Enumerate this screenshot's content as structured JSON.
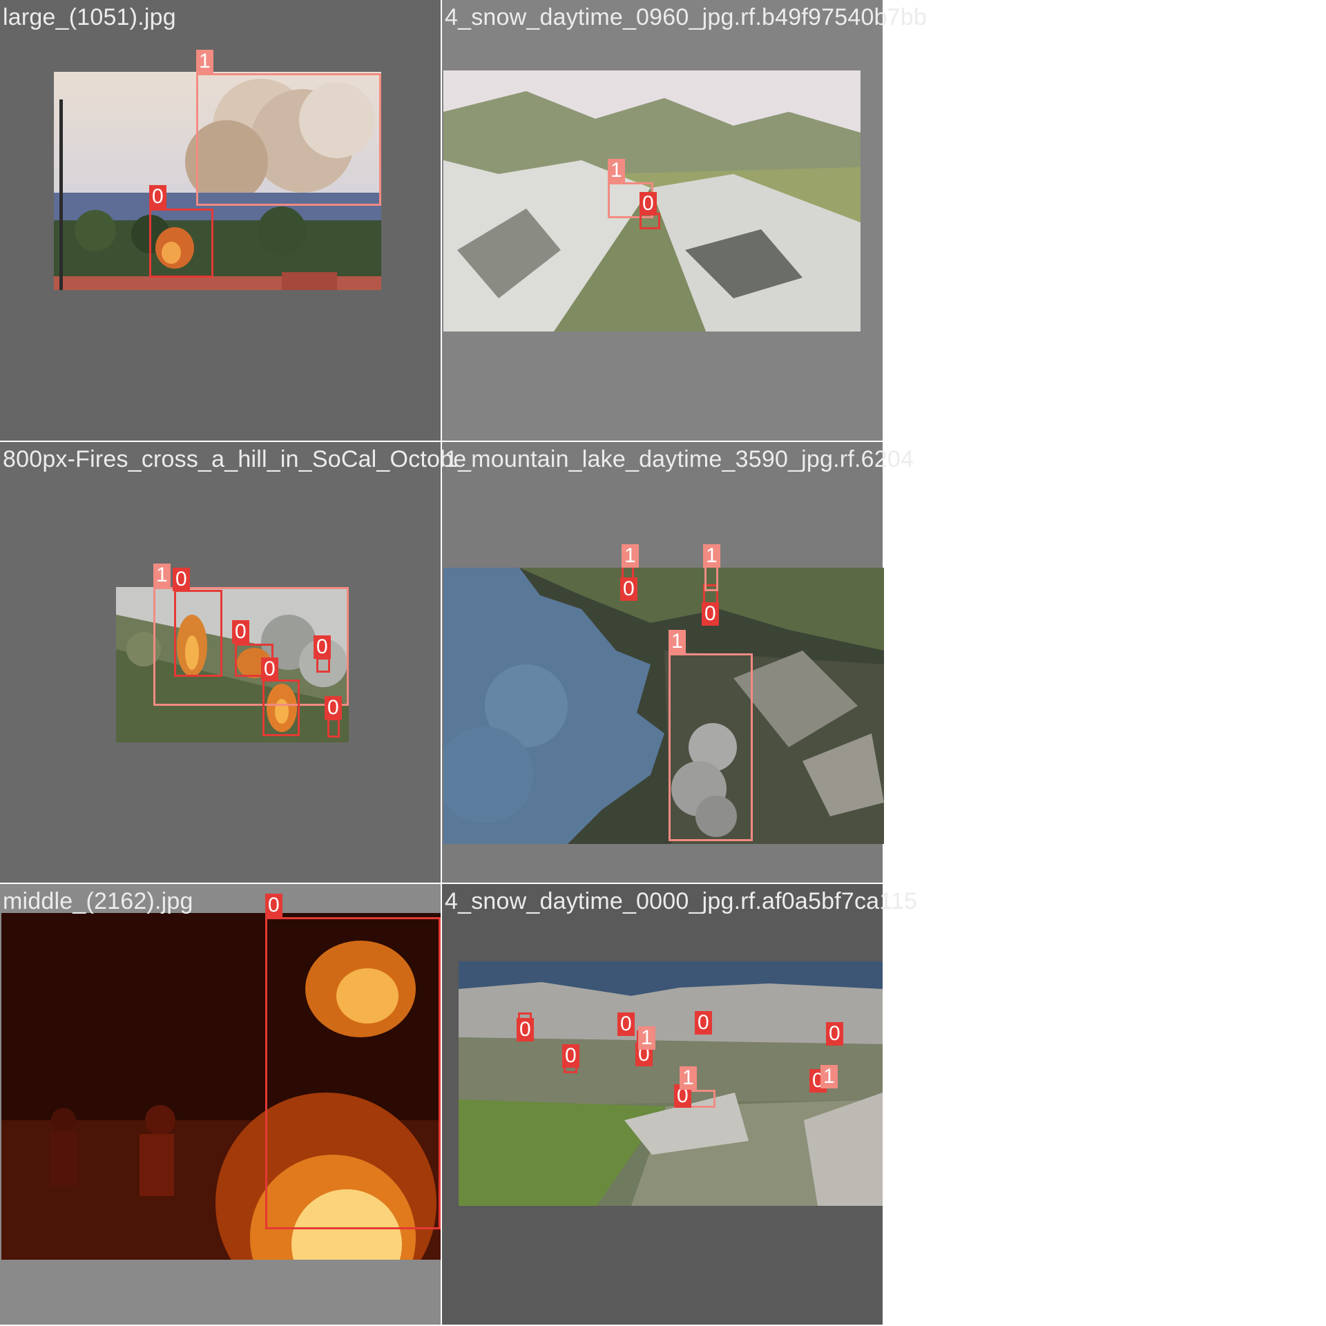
{
  "tiles": [
    {
      "filename": "large_(1051).jpg",
      "labels": [
        "1",
        "0"
      ]
    },
    {
      "filename": "4_snow_daytime_0960_jpg.rf.b49f97540b7bb",
      "labels": [
        "1",
        "0"
      ]
    },
    {
      "filename": "800px-Fires_cross_a_hill_in_SoCal_Octobe",
      "labels": [
        "1",
        "0",
        "0",
        "0",
        "0",
        "0"
      ]
    },
    {
      "filename": "1_mountain_lake_daytime_3590_jpg.rf.6204",
      "labels": [
        "1",
        "0",
        "1",
        "0",
        "1"
      ]
    },
    {
      "filename": "middle_(2162).jpg",
      "labels": [
        "0"
      ]
    },
    {
      "filename": "4_snow_daytime_0000_jpg.rf.af0a5bf7ca115",
      "labels": [
        "0",
        "0",
        "0",
        "0",
        "0",
        "0",
        "1",
        "0",
        "1",
        "0",
        "1"
      ]
    }
  ],
  "colors": {
    "class_0": "#e53935",
    "class_1": "#f28b82",
    "tile_bg_dark": "#666666",
    "tile_bg_mid": "#838383",
    "tile_bg_darker": "#5a5a5a"
  }
}
